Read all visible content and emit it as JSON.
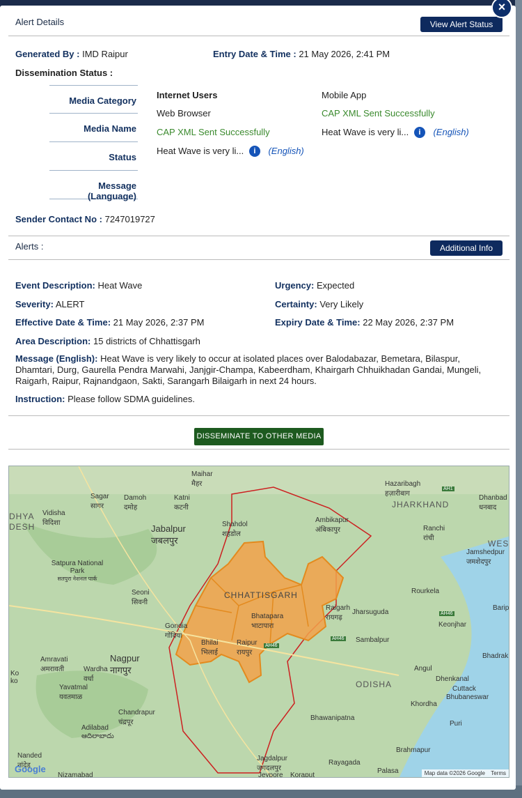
{
  "modal": {
    "close_glyph": "×",
    "alert_details_title": "Alert Details",
    "view_status_btn": "View Alert Status",
    "generated_by_label": "Generated By :",
    "generated_by_value": "IMD Raipur",
    "entry_date_label": "Entry Date & Time :",
    "entry_date_value": "21 May 2026, 2:41 PM",
    "dissemination_label": "Dissemination Status :",
    "categories": [
      "Media Category",
      "Media Name",
      "Status",
      "Message (Language)"
    ],
    "col1": {
      "category": "Internet Users",
      "name": "Web Browser",
      "status": "CAP XML Sent Successfully",
      "message": "Heat Wave is very li...",
      "language": "(English)"
    },
    "col2": {
      "category": "Mobile App",
      "status": "CAP XML Sent Successfully",
      "message": "Heat Wave is very li...",
      "language": "(English)"
    },
    "sender_label": "Sender Contact No :",
    "sender_value": "7247019727",
    "alerts_title": "Alerts :",
    "additional_btn": "Additional Info",
    "event_label": "Event Description:",
    "event_value": "Heat Wave",
    "urgency_label": "Urgency:",
    "urgency_value": "Expected",
    "severity_label": "Severity:",
    "severity_value": "ALERT",
    "certainty_label": "Certainty:",
    "certainty_value": "Very Likely",
    "effective_label": "Effective Date & Time:",
    "effective_value": "21 May 2026, 2:37 PM",
    "expiry_label": "Expiry Date & Time:",
    "expiry_value": "22 May 2026, 2:37 PM",
    "area_label": "Area Description:",
    "area_value": "15 districts of Chhattisgarh",
    "message_label": "Message (English):",
    "message_value": "Heat Wave is very likely to occur at isolated places over Balodabazar, Bemetara, Bilaspur, Dhamtari, Durg, Gaurella Pendra Marwahi, Janjgir-Champa, Kabeerdham, Khairgarh Chhuikhadan Gandai, Mungeli, Raigarh, Raipur, Rajnandgaon, Sakti, Sarangarh Bilaigarh in next 24 hours.",
    "instruction_label": "Instruction:",
    "instruction_value": "Please follow SDMA guidelines.",
    "disseminate_btn": "DISSEMINATE TO OTHER MEDIA"
  },
  "map": {
    "labels": [
      {
        "text": "Sagar",
        "t2": "सागर"
      },
      {
        "text": "Damoh",
        "t2": "दमोह"
      },
      {
        "text": "Katni",
        "t2": "कटनी"
      },
      {
        "text": "Maihar",
        "t2": "मैहर"
      },
      {
        "text": "Vidisha",
        "t2": "विदिशा"
      },
      {
        "text": "Jabalpur",
        "t2": "जबलपुर"
      },
      {
        "text": "Shahdol",
        "t2": "शहडोल"
      },
      {
        "text": "Ambikapur",
        "t2": "अंबिकापुर"
      },
      {
        "text": "Hazaribagh",
        "t2": "हज़ारीबाग"
      },
      {
        "text": "Dhanbad",
        "t2": "धनबाद"
      },
      {
        "text": "Ranchi",
        "t2": "रांची"
      },
      {
        "text": "Jamshedpur",
        "t2": "जमशेदपुर"
      },
      {
        "text": "Satpura National Park",
        "t2": "सतपुरा नेशनल पार्क"
      },
      {
        "text": "Seoni",
        "t2": "सिवनी"
      },
      {
        "text": "Gondia",
        "t2": "गोंदिया"
      },
      {
        "text": "Nagpur",
        "t2": "नागपुर"
      },
      {
        "text": "Bhilai",
        "t2": "भिलाई"
      },
      {
        "text": "Raipur",
        "t2": "रायपुर"
      },
      {
        "text": "Bhatapara",
        "t2": "भाटापारा"
      },
      {
        "text": "Raigarh",
        "t2": "रायगढ़"
      },
      {
        "text": "Jharsuguda",
        "t2": ""
      },
      {
        "text": "Rourkela",
        "t2": ""
      },
      {
        "text": "Sambalpur",
        "t2": ""
      },
      {
        "text": "Keonjhar",
        "t2": ""
      },
      {
        "text": "Amravati",
        "t2": "अमरावती"
      },
      {
        "text": "Wardha",
        "t2": "वर्धा"
      },
      {
        "text": "Yavatmal",
        "t2": "यवतमाळ"
      },
      {
        "text": "Chandrapur",
        "t2": "चंद्रपूर"
      },
      {
        "text": "Adilabad",
        "t2": "ఆదిలాబాదు"
      },
      {
        "text": "Nanded",
        "t2": "नांदेड"
      },
      {
        "text": "Nizamabad",
        "t2": ""
      },
      {
        "text": "Angul",
        "t2": ""
      },
      {
        "text": "Dhenkanal",
        "t2": ""
      },
      {
        "text": "Cuttack",
        "t2": ""
      },
      {
        "text": "Bhubaneswar",
        "t2": ""
      },
      {
        "text": "Khordha",
        "t2": ""
      },
      {
        "text": "Bhawanipatna",
        "t2": ""
      },
      {
        "text": "Puri",
        "t2": ""
      },
      {
        "text": "Brahmapur",
        "t2": ""
      },
      {
        "text": "Jagdalpur",
        "t2": "जगदलपुर"
      },
      {
        "text": "Jeypore",
        "t2": ""
      },
      {
        "text": "Koraput",
        "t2": ""
      },
      {
        "text": "Rayagada",
        "t2": ""
      },
      {
        "text": "Palasa",
        "t2": ""
      },
      {
        "text": "Bhadrak",
        "t2": ""
      },
      {
        "text": "Barip",
        "t2": ""
      },
      {
        "text": "Ko",
        "t2": "ko"
      }
    ],
    "regions": [
      "CHHATTISGARH",
      "JHARKHAND",
      "ODISHA",
      "DHYA",
      "DESH",
      "WES"
    ],
    "road_ah1": "AH1",
    "road_ah46": "AH46",
    "road_ah46b": "AH46",
    "road_ah46c": "AH46",
    "google": "Google",
    "attribution": "Map data ©2026 Google",
    "terms": "Terms"
  }
}
